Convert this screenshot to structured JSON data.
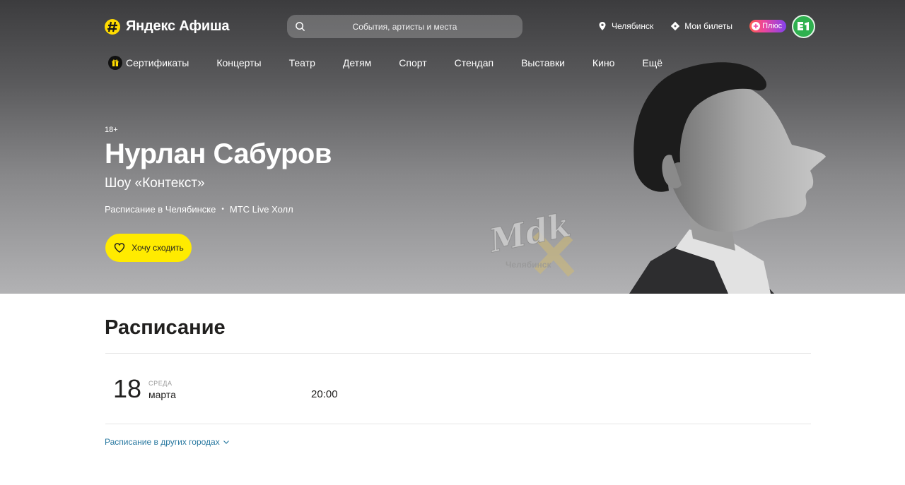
{
  "header": {
    "logo_text": "Яндекс Афиша",
    "search_placeholder": "События, артисты и места",
    "city": "Челябинск",
    "tickets": "Мои билеты",
    "plus": "Плюс"
  },
  "nav": {
    "items": [
      "Сертификаты",
      "Концерты",
      "Театр",
      "Детям",
      "Спорт",
      "Стендап",
      "Выставки",
      "Кино",
      "Ещё"
    ]
  },
  "event": {
    "age": "18+",
    "title": "Нурлан Сабуров",
    "subtitle": "Шоу «Контекст»",
    "schedule_link": "Расписание в Челябинске",
    "dot": "•",
    "venue": "МТС Live Холл",
    "want_button": "Хочу сходить"
  },
  "watermark": {
    "text": "Mdk",
    "city": "Челябинск"
  },
  "schedule": {
    "title": "Расписание",
    "day": "18",
    "weekday": "СРЕДА",
    "month": "марта",
    "time": "20:00",
    "other_cities": "Расписание в других городах"
  },
  "colors": {
    "accent_yellow": "#ffeb00",
    "link_blue": "#2878a0",
    "avatar_green": "#2fb04f"
  },
  "icons": [
    "afisha-logo-icon",
    "search-icon",
    "location-pin-icon",
    "ticket-icon",
    "plus-icon",
    "avatar-icon",
    "gift-icon",
    "heart-icon",
    "chevron-down-icon"
  ]
}
